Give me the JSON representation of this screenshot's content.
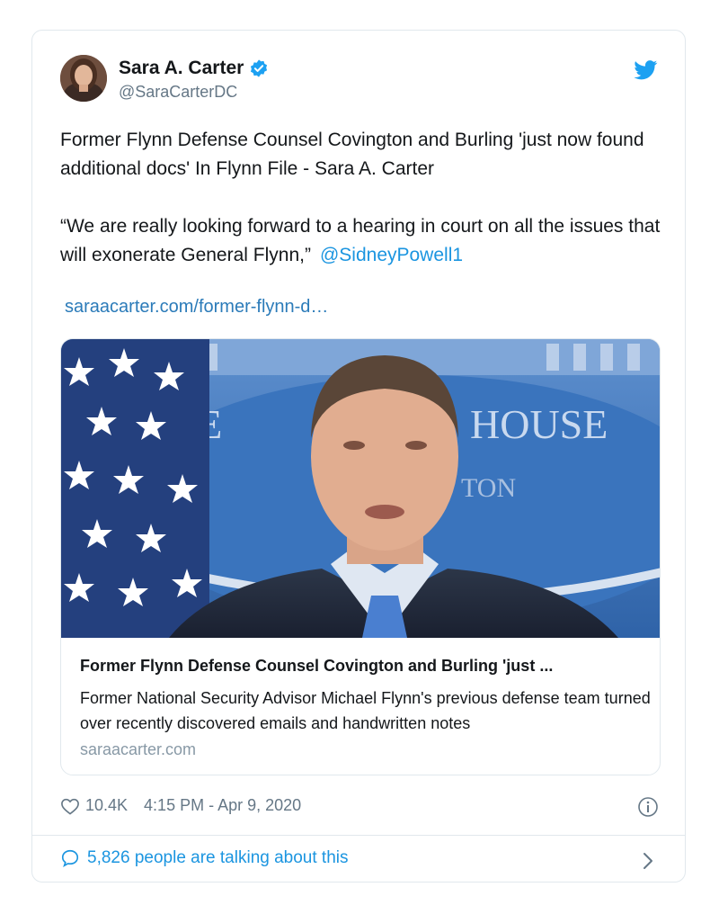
{
  "tweet": {
    "author_name": "Sara A. Carter",
    "author_handle": "@SaraCarterDC",
    "text_para1": "Former Flynn Defense Counsel Covington and Burling 'just now found additional docs' In Flynn File - Sara A. Carter",
    "text_para2": "“We are really looking forward to a hearing in court on all the issues that will exonerate General Flynn,”",
    "mention": "@SidneyPowell1",
    "link_url": "saraacarter.com/former-flynn-d…"
  },
  "link_card": {
    "title": "Former Flynn Defense Counsel Covington and Burling 'just ...",
    "description": "Former National Security Advisor Michael Flynn's previous defense team turned over recently discovered emails and handwritten notes",
    "domain": "saraacarter.com",
    "image_sign_text": "HE   HOUSE",
    "image_sign_sub": "TON"
  },
  "footer": {
    "likes": "10.4K",
    "timestamp": "4:15 PM - Apr 9, 2020",
    "conversation": "5,826 people are talking about this"
  },
  "icons": {
    "verified": "verified-badge-icon",
    "bird": "twitter-bird-icon",
    "heart": "heart-icon",
    "info": "info-icon",
    "bubble": "speech-bubble-icon",
    "chevron": "chevron-right-icon"
  },
  "colors": {
    "accent": "#1b95e0",
    "link": "#2b7bb9",
    "muted": "#657786",
    "border": "#e1e8ed"
  }
}
